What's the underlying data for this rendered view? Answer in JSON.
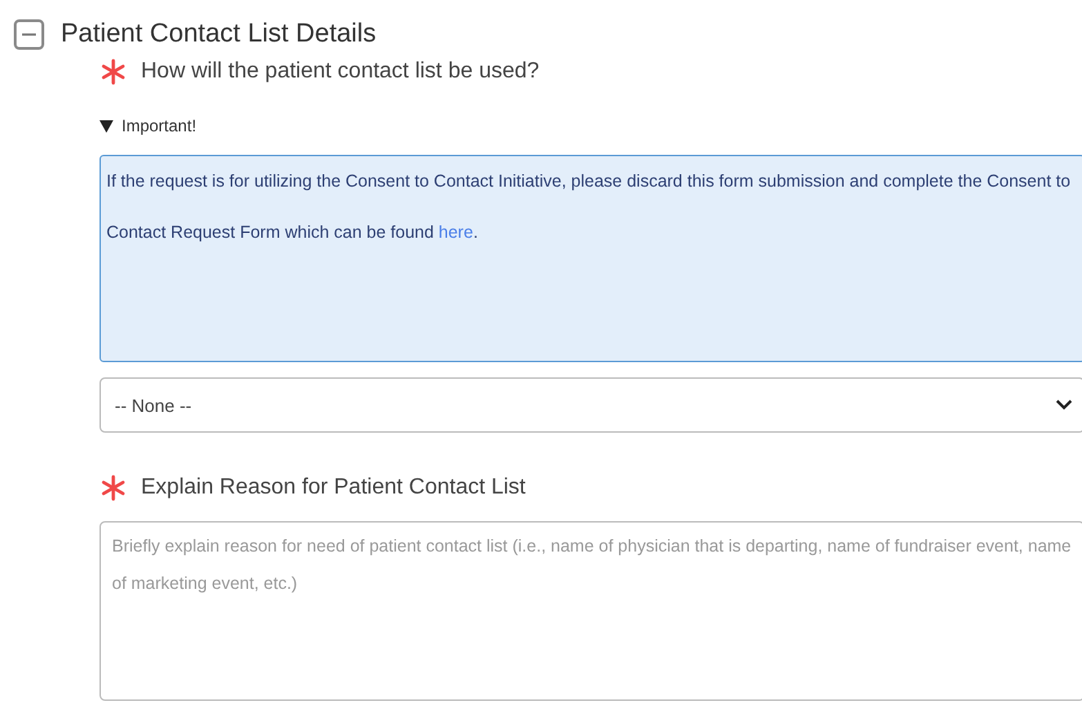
{
  "section": {
    "title": "Patient Contact List Details",
    "expanded": true
  },
  "questions": [
    {
      "kind": "select",
      "label": "How will the patient contact list be used?",
      "required": true,
      "notice": {
        "title": "Important!",
        "expanded": true,
        "text": "If the request is for utilizing the Consent to Contact Initiative, please discard this form submission and complete the Consent to Contact Request Form which can be found ",
        "link": "here",
        "suffix": "."
      },
      "value": "-- None --"
    },
    {
      "kind": "textarea",
      "label": "Explain Reason for Patient Contact List",
      "required": true,
      "placeholder": "Briefly explain reason for need of patient contact list (i.e., name of physician that is departing, name of fundraiser event, name of marketing event, etc.)"
    }
  ]
}
